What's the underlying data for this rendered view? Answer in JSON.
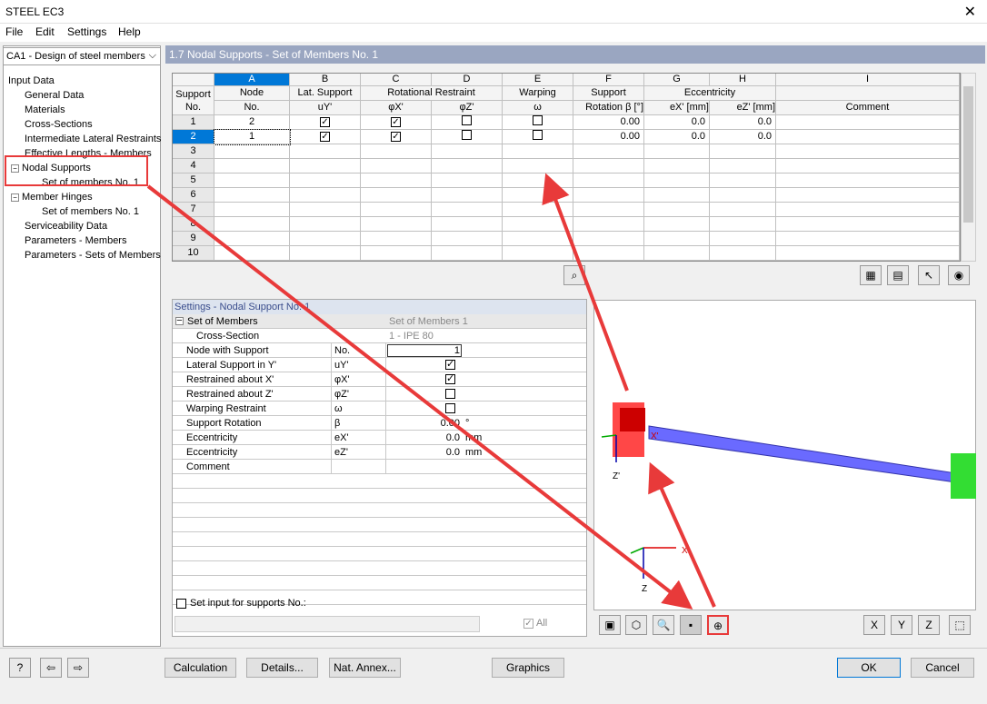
{
  "window": {
    "title": "STEEL EC3",
    "close": "✕"
  },
  "menu": {
    "file": "File",
    "edit": "Edit",
    "settings": "Settings",
    "help": "Help"
  },
  "case": {
    "label": "CA1 - Design of steel members",
    "arrow": "⌵"
  },
  "tree": {
    "root": "Input Data",
    "items": [
      "General Data",
      "Materials",
      "Cross-Sections",
      "Intermediate Lateral Restraints",
      "Effective Lengths - Members",
      "Nodal Supports",
      "Set of members No. 1",
      "Member Hinges",
      "Set of members No. 1",
      "Serviceability Data",
      "Parameters - Members",
      "Parameters - Sets of Members"
    ]
  },
  "panel": {
    "title": "1.7 Nodal Supports - Set of Members No. 1"
  },
  "grid": {
    "letters": [
      "A",
      "B",
      "C",
      "D",
      "E",
      "F",
      "G",
      "H",
      "I"
    ],
    "support_no": [
      "Support",
      "No."
    ],
    "top": [
      "Node",
      "Lat. Support",
      "Rotational Restraint",
      "Warping",
      "Support",
      "Eccentricity",
      "Comment"
    ],
    "sub": [
      "No.",
      "uY'",
      "φX'",
      "φZ'",
      "ω",
      "Rotation β [°]",
      "eX' [mm]",
      "eZ' [mm]",
      "Comment"
    ],
    "rows": [
      {
        "n": "1",
        "node": "2",
        "lat": true,
        "px": true,
        "pz": false,
        "w": false,
        "rot": "0.00",
        "ex": "0.0",
        "ez": "0.0"
      },
      {
        "n": "2",
        "node": "1",
        "lat": true,
        "px": true,
        "pz": false,
        "w": false,
        "rot": "0.00",
        "ex": "0.0",
        "ez": "0.0"
      }
    ],
    "empty_rows": [
      "3",
      "4",
      "5",
      "6",
      "7",
      "8",
      "9",
      "10"
    ]
  },
  "settings": {
    "title": "Settings - Nodal Support No. 1",
    "group": "Set of Members",
    "group_val": "Set of Members 1",
    "cs": "Cross-Section",
    "cs_val": "1 - IPE 80",
    "rows": [
      {
        "label": "Node with Support",
        "sym": "No.",
        "val": "1",
        "unit": "",
        "chk": null
      },
      {
        "label": "Lateral Support in Y'",
        "sym": "uY'",
        "val": "",
        "unit": "",
        "chk": true
      },
      {
        "label": "Restrained about X'",
        "sym": "φX'",
        "val": "",
        "unit": "",
        "chk": true
      },
      {
        "label": "Restrained about Z'",
        "sym": "φZ'",
        "val": "",
        "unit": "",
        "chk": false
      },
      {
        "label": "Warping Restraint",
        "sym": "ω",
        "val": "",
        "unit": "",
        "chk": false
      },
      {
        "label": "Support Rotation",
        "sym": "β",
        "val": "0.00",
        "unit": "°",
        "chk": null
      },
      {
        "label": "Eccentricity",
        "sym": "eX'",
        "val": "0.0",
        "unit": "mm",
        "chk": null
      },
      {
        "label": "Eccentricity",
        "sym": "eZ'",
        "val": "0.0",
        "unit": "mm",
        "chk": null
      },
      {
        "label": "Comment",
        "sym": "",
        "val": "",
        "unit": "",
        "chk": null
      }
    ],
    "set_input": "Set input for supports No.:",
    "all": "All"
  },
  "graphics": {
    "x": "X",
    "z": "Z",
    "x2": "X'",
    "z2": "Z'"
  },
  "buttons": {
    "calc": "Calculation",
    "details": "Details...",
    "annex": "Nat. Annex...",
    "graphics": "Graphics",
    "ok": "OK",
    "cancel": "Cancel"
  },
  "colors": {
    "accent": "#e83a3a",
    "selected": "#0078d7",
    "member": "#6a6aff"
  }
}
